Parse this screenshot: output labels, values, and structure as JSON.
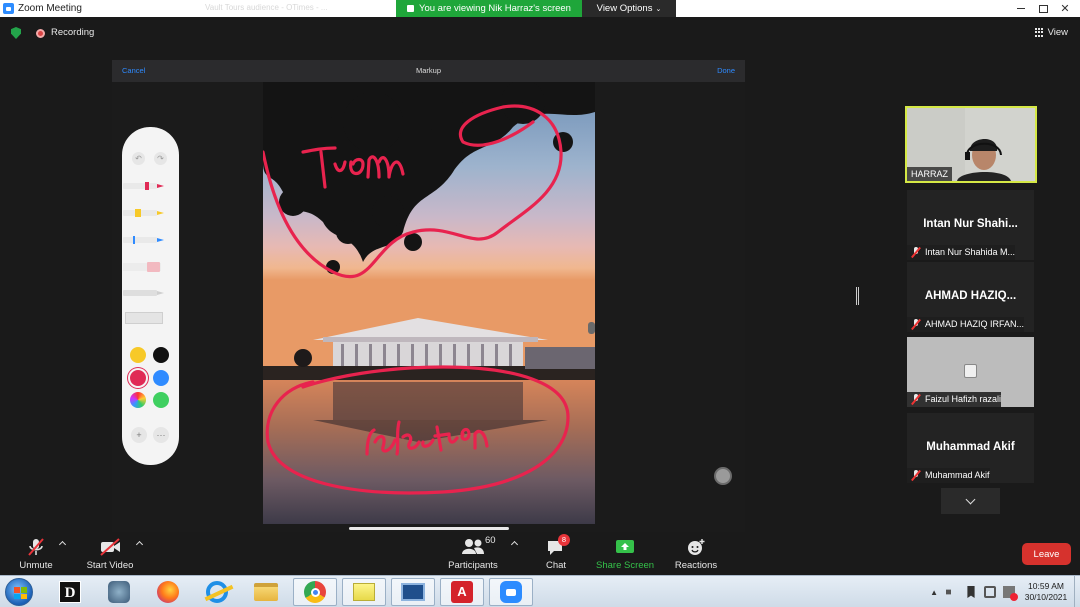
{
  "window": {
    "title": "Zoom Meeting",
    "background_hint": "Vault Tours audience - OTimes - ...",
    "viewing_banner": "You are viewing Nik Harraz's screen",
    "view_options": "View Options"
  },
  "status": {
    "recording_label": "Recording",
    "view_label": "View"
  },
  "shared_screen": {
    "markup_title": "Markup",
    "cancel_label": "Cancel",
    "done_label": "Done",
    "annotations": [
      "from",
      "reflection"
    ]
  },
  "palette": {
    "colors": [
      "#f7c928",
      "#111111",
      "#e02a55",
      "#2f8bff",
      "rainbow",
      "#3fcf60"
    ],
    "selected_color": "#e02a55",
    "undo_icon": "undo-icon",
    "redo_icon": "redo-icon"
  },
  "participants_panel": {
    "self": {
      "name": "HARRAZ"
    },
    "tiles": [
      {
        "big": "Intan Nur Shahi...",
        "small": "Intan Nur Shahida M..."
      },
      {
        "big": "AHMAD  HAZIQ...",
        "small": "AHMAD HAZIQ IRFAN..."
      },
      {
        "big": "",
        "small": "Faizul Hafizh razali"
      },
      {
        "big": "Muhammad Akif",
        "small": "Muhammad Akif"
      }
    ]
  },
  "toolbar": {
    "unmute": "Unmute",
    "start_video": "Start Video",
    "participants": "Participants",
    "participants_count": "60",
    "chat": "Chat",
    "chat_badge": "8",
    "share_screen": "Share Screen",
    "reactions": "Reactions",
    "leave": "Leave"
  },
  "taskbar": {
    "time": "10:59 AM",
    "date": "30/10/2021",
    "apps": [
      "windows-start",
      "dictionary",
      "game",
      "firefox",
      "internet-explorer",
      "file-explorer",
      "chrome",
      "sticky-notes",
      "remote-desktop",
      "acrobat",
      "zoom"
    ]
  },
  "colors": {
    "accent_green": "#1fa63a",
    "leave_red": "#d6322d",
    "markup_ink": "#e8234e",
    "active_speaker": "#d5e845"
  }
}
